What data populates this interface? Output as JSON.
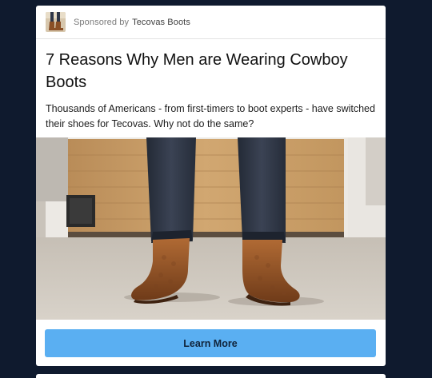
{
  "ad": {
    "sponsored_prefix": "Sponsored by",
    "sponsor_name": "Tecovas Boots",
    "avatar_icon": "boots-thumbnail-icon",
    "title": "7 Reasons Why Men are Wearing Cowboy Boots",
    "body": "Thousands of Americans - from first-timers to boot experts - have switched their shoes for Tecovas. Why not do the same?",
    "image_subject": "man-wearing-brown-cowboy-boots-photo",
    "cta_label": "Learn More"
  },
  "colors": {
    "background": "#0f1a2e",
    "card": "#ffffff",
    "cta": "#5aaff2",
    "cta_text": "#10233a",
    "boot_leather": "#9a5a2e",
    "denim": "#2e3646",
    "wood_door": "#c89a62"
  }
}
